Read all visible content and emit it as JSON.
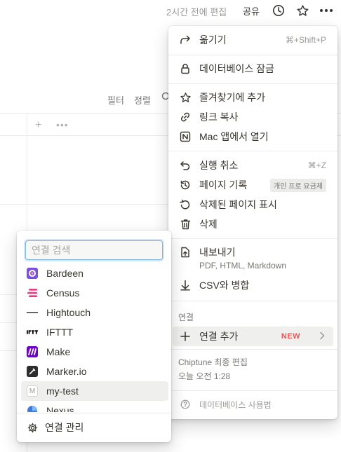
{
  "topbar": {
    "edited": "2시간 전에 편집",
    "share": "공유",
    "icons": [
      "clock-icon",
      "star-icon",
      "more-horizontal-icon"
    ]
  },
  "db_toolbar": {
    "filter": "필터",
    "sort": "정렬"
  },
  "menu": {
    "move": {
      "label": "옮기기",
      "shortcut": "⌘+Shift+P"
    },
    "lock": {
      "label": "데이터베이스 잠금"
    },
    "favorite": {
      "label": "즐겨찾기에 추가"
    },
    "copy_link": {
      "label": "링크 복사"
    },
    "open_mac": {
      "label": "Mac 앱에서 열기"
    },
    "undo": {
      "label": "실행 취소",
      "shortcut": "⌘+Z"
    },
    "history": {
      "label": "페이지 기록",
      "badge": "개인 프로 요금제"
    },
    "deleted": {
      "label": "삭제된 페이지 표시"
    },
    "delete": {
      "label": "삭제"
    },
    "export": {
      "label": "내보내기",
      "sub": "PDF, HTML, Markdown"
    },
    "merge_csv": {
      "label": "CSV와 병합"
    },
    "connections_section": "연결",
    "add_connection": {
      "label": "연결 추가",
      "badge": "NEW"
    },
    "last_edited_by": "Chiptune 최종 편집",
    "last_edited_time": "오늘 오전 1:28",
    "help": "데이터베이스 사용법"
  },
  "submenu": {
    "search_placeholder": "연결 검색",
    "items": [
      {
        "name": "Bardeen",
        "icon": "bardeen-logo-icon",
        "color": "#7b4fe0"
      },
      {
        "name": "Census",
        "icon": "census-logo-icon",
        "color": "#f2357d"
      },
      {
        "name": "Hightouch",
        "icon": "hightouch-logo-icon",
        "color": "#222222"
      },
      {
        "name": "IFTTT",
        "icon": "ifttt-logo-icon",
        "color": "#000000"
      },
      {
        "name": "Make",
        "icon": "make-logo-icon",
        "color": "#6d00cc"
      },
      {
        "name": "Marker.io",
        "icon": "markerio-logo-icon",
        "color": "#2d2d2d"
      },
      {
        "name": "my-test",
        "icon": "letter-m-icon",
        "color": "#ffffff"
      },
      {
        "name": "Nexus",
        "icon": "nexus-logo-icon",
        "color": "#3d7be0"
      }
    ],
    "manage": "연결 관리"
  }
}
